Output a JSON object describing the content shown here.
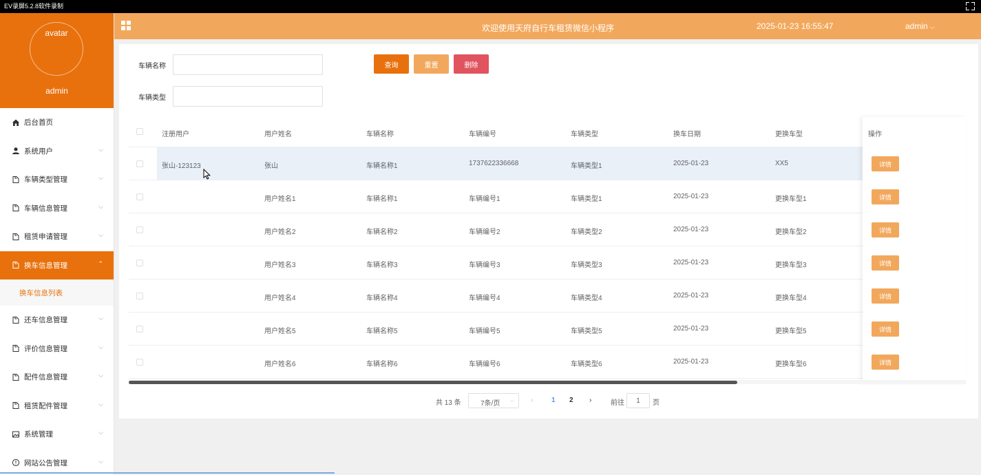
{
  "recorder": {
    "title": "EV录屏5.2.8软件录制"
  },
  "sidebar": {
    "avatar_text": "avatar",
    "username": "admin",
    "items": [
      {
        "label": "后台首页",
        "icon": "home-icon"
      },
      {
        "label": "系统用户",
        "icon": "user-icon"
      },
      {
        "label": "车辆类型管理",
        "icon": "doc-icon"
      },
      {
        "label": "车辆信息管理",
        "icon": "doc-icon"
      },
      {
        "label": "租赁申请管理",
        "icon": "doc-icon"
      },
      {
        "label": "换车信息管理",
        "icon": "doc-icon",
        "active": true
      },
      {
        "label": "还车信息管理",
        "icon": "doc-icon"
      },
      {
        "label": "评价信息管理",
        "icon": "doc-icon"
      },
      {
        "label": "配件信息管理",
        "icon": "doc-icon"
      },
      {
        "label": "租赁配件管理",
        "icon": "doc-icon"
      },
      {
        "label": "系统管理",
        "icon": "image-icon"
      },
      {
        "label": "网站公告管理",
        "icon": "info-icon"
      }
    ],
    "submenu_label": "换车信息列表"
  },
  "header": {
    "welcome": "欢迎使用天府自行车租赁微信小程序",
    "datetime": "2025-01-23 16:55:47",
    "user": "admin"
  },
  "search": {
    "vehicle_name_label": "车辆名称",
    "vehicle_type_label": "车辆类型",
    "query_btn": "查询",
    "reset_btn": "重置",
    "delete_btn": "删除"
  },
  "table": {
    "headers": [
      "注册用户",
      "用户姓名",
      "车辆名称",
      "车辆编号",
      "车辆类型",
      "换车日期",
      "更换车型",
      "操作"
    ],
    "rows": [
      [
        "张山-123123",
        "张山",
        "车辆名称1",
        "1737622336668",
        "车辆类型1",
        "2025-01-23",
        "XX5"
      ],
      [
        "",
        "用户姓名1",
        "车辆名称1",
        "车辆编号1",
        "车辆类型1",
        "2025-01-23",
        "更换车型1"
      ],
      [
        "",
        "用户姓名2",
        "车辆名称2",
        "车辆编号2",
        "车辆类型2",
        "2025-01-23",
        "更换车型2"
      ],
      [
        "",
        "用户姓名3",
        "车辆名称3",
        "车辆编号3",
        "车辆类型3",
        "2025-01-23",
        "更换车型3"
      ],
      [
        "",
        "用户姓名4",
        "车辆名称4",
        "车辆编号4",
        "车辆类型4",
        "2025-01-23",
        "更换车型4"
      ],
      [
        "",
        "用户姓名5",
        "车辆名称5",
        "车辆编号5",
        "车辆类型5",
        "2025-01-23",
        "更换车型5"
      ],
      [
        "",
        "用户姓名6",
        "车辆名称6",
        "车辆编号6",
        "车辆类型6",
        "2025-01-23",
        "更换车型6"
      ]
    ],
    "detail_btn": "详情"
  },
  "pagination": {
    "total": "共 13 条",
    "page_size": "7条/页",
    "pages": [
      "1",
      "2"
    ],
    "current": "1",
    "goto_prefix": "前往",
    "goto_value": "1",
    "goto_suffix": "页"
  },
  "colors": {
    "primary": "#e8710d",
    "header": "#f2a85c",
    "danger": "#e0535f",
    "row_highlight": "#eaf0f8"
  }
}
